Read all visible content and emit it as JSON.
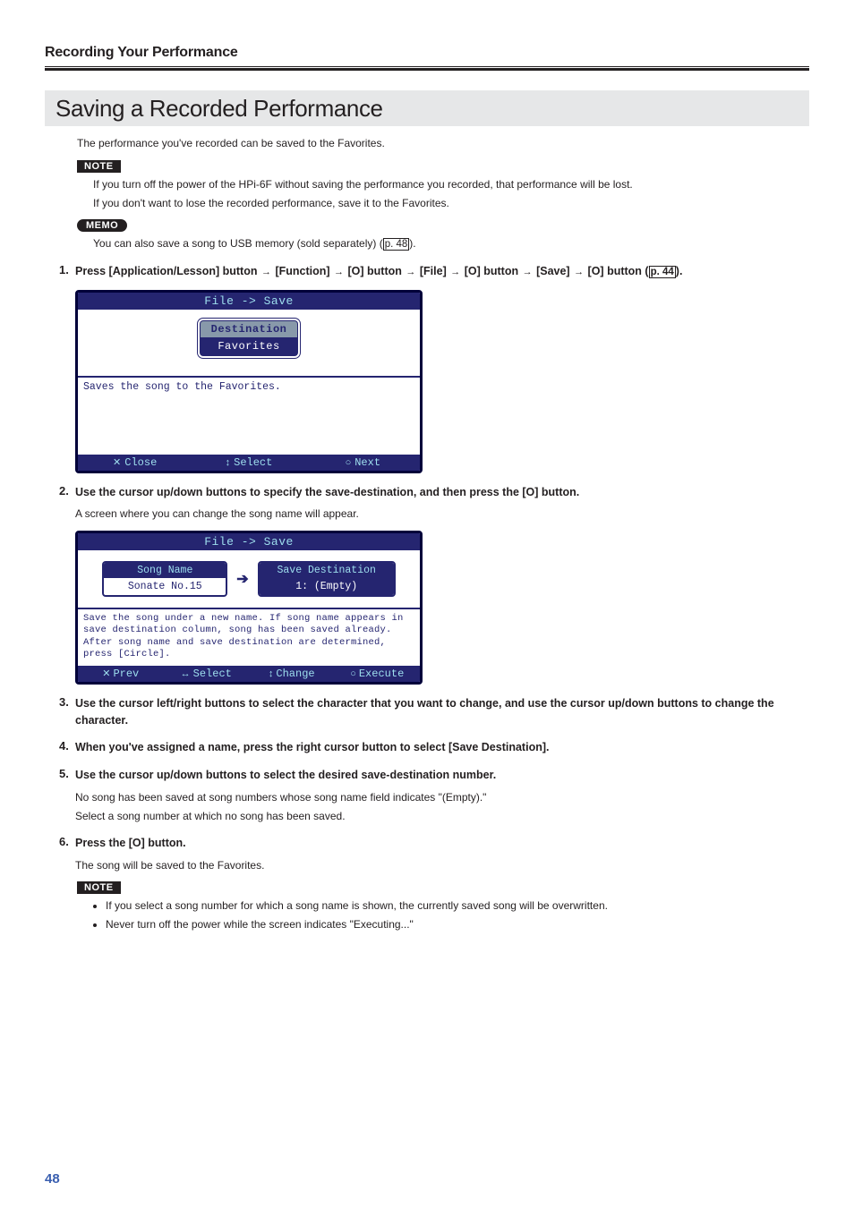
{
  "breadcrumb": "Recording Your Performance",
  "section_title": "Saving a Recorded Performance",
  "intro": "The performance you've recorded can be saved to the Favorites.",
  "badges": {
    "note": "NOTE",
    "memo": "MEMO"
  },
  "note1": {
    "line1": "If you turn off the power of the HPi-6F without saving the performance you recorded, that performance will be lost.",
    "line2": "If you don't want to lose the recorded performance, save it to the Favorites."
  },
  "memo1": {
    "line_pre": "You can also save a song to USB memory (sold separately) (",
    "ref": "p. 48",
    "line_post": ")."
  },
  "steps": {
    "s1": {
      "num": "1.",
      "seg1": "Press [Application/Lesson] button ",
      "seg2": " [Function] ",
      "seg3": " [O] button ",
      "seg4": " [File] ",
      "seg5": " [O] button ",
      "seg6": " [Save] ",
      "seg7": " [O] button (",
      "ref": "p. 44",
      "seg8": ")."
    },
    "s2": {
      "num": "2.",
      "text": "Use the cursor up/down buttons to specify the save-destination, and then press the [O] button.",
      "sub": "A screen where you can change the song name will appear."
    },
    "s3": {
      "num": "3.",
      "text": "Use the cursor left/right buttons to select the character that you want to change, and use the cursor up/down buttons to change the character."
    },
    "s4": {
      "num": "4.",
      "text": "When you've assigned a name, press the right cursor button to select [Save Destination]."
    },
    "s5": {
      "num": "5.",
      "text": "Use the cursor up/down buttons to select the desired save-destination number.",
      "sub1": "No song has been saved at song numbers whose song name field indicates \"(Empty).\"",
      "sub2": "Select a song number at which no song has been saved."
    },
    "s6": {
      "num": "6.",
      "text": "Press the [O] button.",
      "sub": "The song will be saved to the Favorites."
    }
  },
  "note2": {
    "b1": "If you select a song number for which a song name is shown, the currently saved song will be overwritten.",
    "b2": "Never turn off the power while the screen indicates \"Executing...\""
  },
  "screen1": {
    "title": "File -> Save",
    "pill_top": "Destination",
    "pill_bot": "Favorites",
    "info": "Saves the song to the Favorites.",
    "close_label": "Close",
    "select_label": "Select",
    "next_label": "Next"
  },
  "screen2": {
    "title": "File -> Save",
    "songname_hd": "Song Name",
    "songname_val": "Sonate No.15",
    "savedest_hd": "Save Destination",
    "savedest_val": "1: (Empty)",
    "info_l1": "Save the song under a new name. If song name appears in",
    "info_l2": "save destination column, song has been saved already.",
    "info_l3": "After song name and save destination are determined,",
    "info_l4": "press [Circle].",
    "prev_label": "Prev",
    "select_label": "Select",
    "change_label": "Change",
    "execute_label": "Execute"
  },
  "page_number": "48"
}
